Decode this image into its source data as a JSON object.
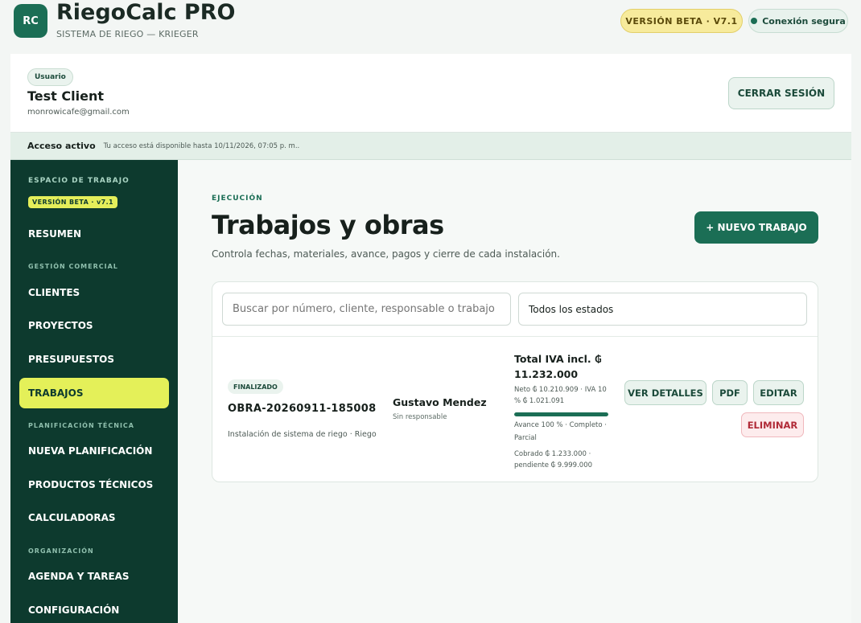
{
  "header": {
    "logo": "RC",
    "title": "RiegoCalc PRO",
    "subtitle": "SISTEMA DE RIEGO — KRIEGER",
    "beta_badge": "VERSIÓN BETA · V7.1",
    "secure_label": "Conexión segura"
  },
  "user": {
    "role": "Usuario",
    "name": "Test Client",
    "email": "monrowicafe@gmail.com",
    "logout_label": "CERRAR SESIÓN"
  },
  "access": {
    "label": "Acceso activo",
    "text": "Tu acceso está disponible hasta 10/11/2026, 07:05 p. m.."
  },
  "sidebar": {
    "workspace_label": "ESPACIO DE TRABAJO",
    "beta_badge": "VERSIÓN BETA · v7.1",
    "sections": {
      "commercial": "GESTIÓN COMERCIAL",
      "technical": "PLANIFICACIÓN TÉCNICA",
      "organization": "ORGANIZACIÓN"
    },
    "items": {
      "summary": "RESUMEN",
      "clients": "CLIENTES",
      "projects": "PROYECTOS",
      "budgets": "PRESUPUESTOS",
      "jobs": "TRABAJOS",
      "new_planning": "NUEVA PLANIFICACIÓN",
      "technical_products": "PRODUCTOS TÉCNICOS",
      "calculators": "CALCULADORAS",
      "agenda": "AGENDA Y TAREAS",
      "settings": "CONFIGURACIÓN"
    },
    "active": "jobs"
  },
  "main": {
    "eyebrow": "EJECUCIÓN",
    "title": "Trabajos y obras",
    "description": "Controla fechas, materiales, avance, pagos y cierre de cada instalación.",
    "new_button": "+ NUEVO TRABAJO",
    "search_placeholder": "Buscar por número, cliente, responsable o trabajo",
    "status_filter": "Todos los estados"
  },
  "job": {
    "status": "FINALIZADO",
    "number": "OBRA-20260911-185008",
    "description": "Instalación de sistema de riego · Riego",
    "client": "Gustavo Mendez",
    "responsible": "Sin responsable",
    "total": "Total IVA incl. ₲ 11.232.000",
    "net": "Neto ₲ 10.210.909 · IVA 10 % ₲ 1.021.091",
    "progress_percent": 100,
    "progress_text": "Avance 100 % · Completo · Parcial",
    "paid": "Cobrado ₲ 1.233.000 · pendiente ₲ 9.999.000",
    "actions": {
      "details": "VER DETALLES",
      "pdf": "PDF",
      "edit": "EDITAR",
      "delete": "ELIMINAR"
    }
  }
}
